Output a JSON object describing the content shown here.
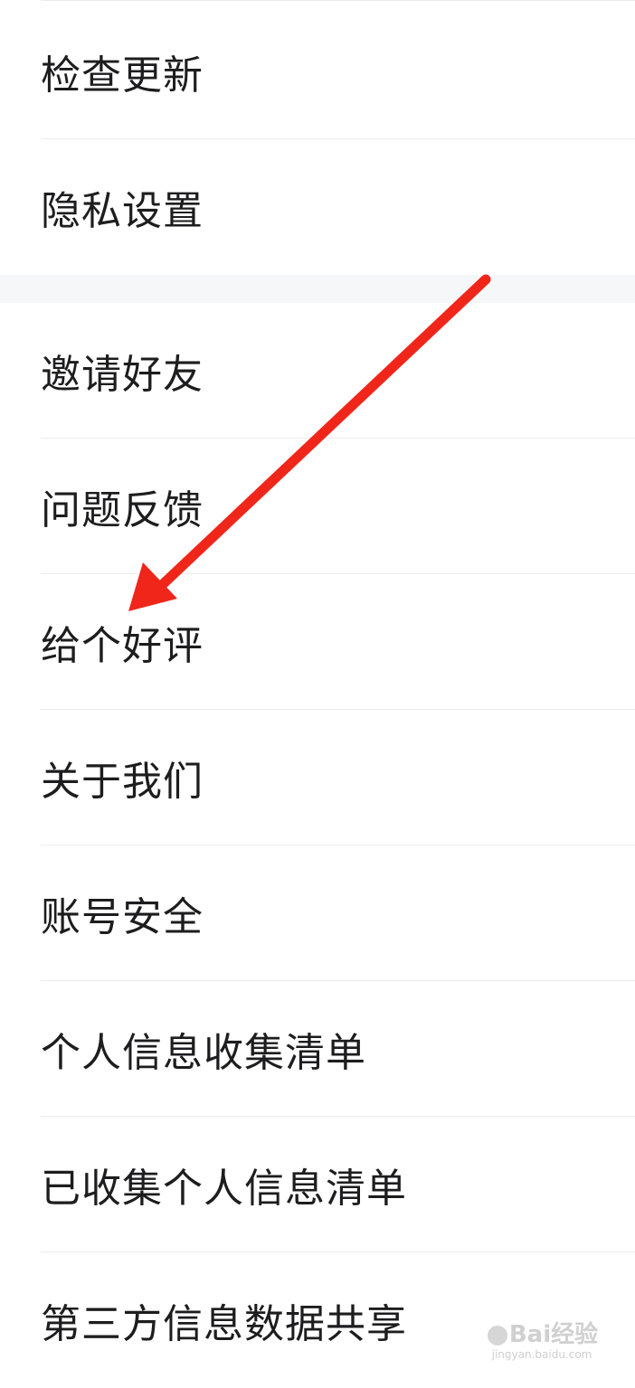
{
  "settings": {
    "group1": [
      {
        "label": "检查更新"
      },
      {
        "label": "隐私设置"
      }
    ],
    "group2": [
      {
        "label": "邀请好友"
      },
      {
        "label": "问题反馈"
      },
      {
        "label": "给个好评"
      },
      {
        "label": "关于我们"
      },
      {
        "label": "账号安全"
      },
      {
        "label": "个人信息收集清单"
      },
      {
        "label": "已收集个人信息清单"
      },
      {
        "label": "第三方信息数据共享"
      }
    ]
  },
  "annotation": {
    "arrow_color": "#f0261b",
    "points_to": "给个好评"
  },
  "watermark": {
    "logo_text": "Bai经验",
    "site": "jingyan.baidu.com"
  }
}
